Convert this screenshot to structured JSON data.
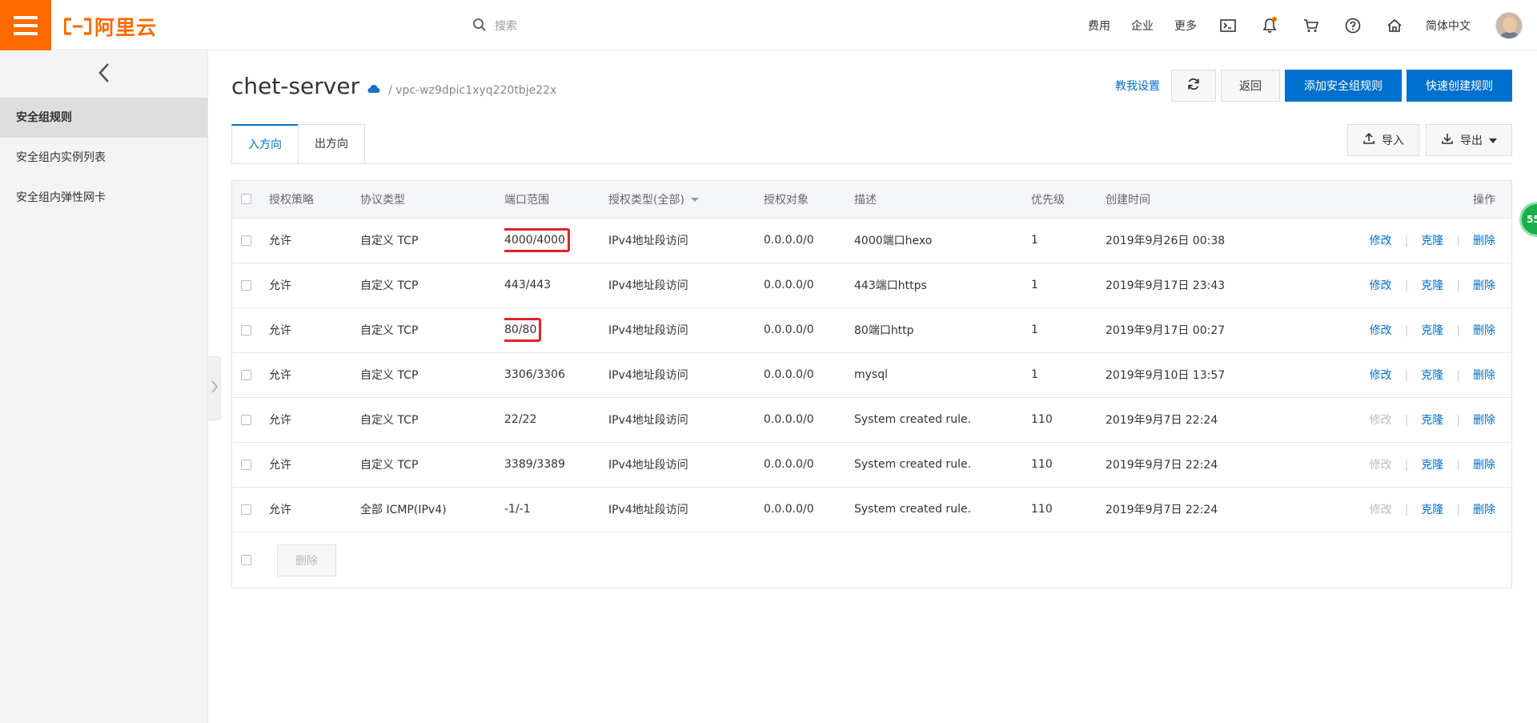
{
  "topbar": {
    "logo_text": "阿里云",
    "search_placeholder": "搜索",
    "links": [
      "费用",
      "企业",
      "更多"
    ],
    "language": "简体中文",
    "brand_color": "#ff6a00"
  },
  "sidebar": {
    "items": [
      {
        "label": "安全组规则",
        "active": true
      },
      {
        "label": "安全组内实例列表",
        "active": false
      },
      {
        "label": "安全组内弹性网卡",
        "active": false
      }
    ]
  },
  "header": {
    "title": "chet-server",
    "vpc": "/ vpc-wz9dpic1xyq220tbje22x",
    "help_link": "教我设置",
    "back_label": "返回",
    "add_rule_label": "添加安全组规则",
    "quick_rule_label": "快速创建规则"
  },
  "tabs": [
    {
      "label": "入方向",
      "active": true
    },
    {
      "label": "出方向",
      "active": false
    }
  ],
  "toolbar": {
    "import_label": "导入",
    "export_label": "导出"
  },
  "table": {
    "headers": {
      "policy": "授权策略",
      "protocol": "协议类型",
      "port": "端口范围",
      "auth_type": "授权类型(全部)",
      "auth_object": "授权对象",
      "desc": "描述",
      "priority": "优先级",
      "created": "创建时间",
      "ops": "操作"
    },
    "op_labels": {
      "edit": "修改",
      "clone": "克隆",
      "delete": "删除"
    },
    "rows": [
      {
        "policy": "允许",
        "protocol": "自定义 TCP",
        "port": "4000/4000",
        "auth_type": "IPv4地址段访问",
        "auth_object": "0.0.0.0/0",
        "desc": "4000端口hexo",
        "priority": "1",
        "created": "2019年9月26日 00:38",
        "edit_enabled": true,
        "highlight": true
      },
      {
        "policy": "允许",
        "protocol": "自定义 TCP",
        "port": "443/443",
        "auth_type": "IPv4地址段访问",
        "auth_object": "0.0.0.0/0",
        "desc": "443端口https",
        "priority": "1",
        "created": "2019年9月17日 23:43",
        "edit_enabled": true,
        "highlight": false
      },
      {
        "policy": "允许",
        "protocol": "自定义 TCP",
        "port": "80/80",
        "auth_type": "IPv4地址段访问",
        "auth_object": "0.0.0.0/0",
        "desc": "80端口http",
        "priority": "1",
        "created": "2019年9月17日 00:27",
        "edit_enabled": true,
        "highlight": true
      },
      {
        "policy": "允许",
        "protocol": "自定义 TCP",
        "port": "3306/3306",
        "auth_type": "IPv4地址段访问",
        "auth_object": "0.0.0.0/0",
        "desc": "mysql",
        "priority": "1",
        "created": "2019年9月10日 13:57",
        "edit_enabled": true,
        "highlight": false
      },
      {
        "policy": "允许",
        "protocol": "自定义 TCP",
        "port": "22/22",
        "auth_type": "IPv4地址段访问",
        "auth_object": "0.0.0.0/0",
        "desc": "System created rule.",
        "priority": "110",
        "created": "2019年9月7日 22:24",
        "edit_enabled": false,
        "highlight": false
      },
      {
        "policy": "允许",
        "protocol": "自定义 TCP",
        "port": "3389/3389",
        "auth_type": "IPv4地址段访问",
        "auth_object": "0.0.0.0/0",
        "desc": "System created rule.",
        "priority": "110",
        "created": "2019年9月7日 22:24",
        "edit_enabled": false,
        "highlight": false
      },
      {
        "policy": "允许",
        "protocol": "全部 ICMP(IPv4)",
        "port": "-1/-1",
        "auth_type": "IPv4地址段访问",
        "auth_object": "0.0.0.0/0",
        "desc": "System created rule.",
        "priority": "110",
        "created": "2019年9月7日 22:24",
        "edit_enabled": false,
        "highlight": false
      }
    ],
    "footer_delete_label": "删除"
  },
  "float_ball": {
    "text": "55"
  }
}
